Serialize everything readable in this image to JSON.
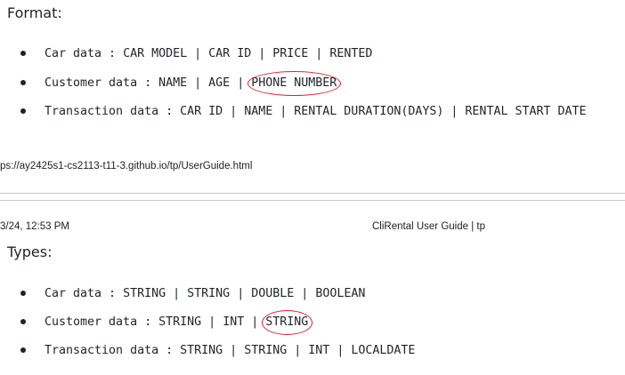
{
  "page1": {
    "heading": "Format:",
    "items": [
      {
        "label": "Car data",
        "separator": " : ",
        "fields": [
          "CAR MODEL",
          "CAR ID",
          "PRICE",
          "RENTED"
        ],
        "circled_index": -1
      },
      {
        "label": "Customer data",
        "separator": " : ",
        "fields": [
          "NAME",
          "AGE",
          "PHONE NUMBER"
        ],
        "circled_index": 2
      },
      {
        "label": "Transaction data",
        "separator": " : ",
        "fields": [
          "CAR ID",
          "NAME",
          "RENTAL DURATION(DAYS)",
          "RENTAL START DATE"
        ],
        "circled_index": -1
      }
    ],
    "footer_url": "ps://ay2425s1-cs2113-t11-3.github.io/tp/UserGuide.html"
  },
  "page2": {
    "header_left": "3/24, 12:53 PM",
    "header_right": "CliRental User Guide | tp",
    "heading": "Types:",
    "items": [
      {
        "label": "Car data",
        "separator": " : ",
        "fields": [
          "STRING",
          "STRING",
          "DOUBLE",
          "BOOLEAN"
        ],
        "circled_index": -1
      },
      {
        "label": "Customer data",
        "separator": " : ",
        "fields": [
          "STRING",
          "INT",
          "STRING"
        ],
        "circled_index": 2
      },
      {
        "label": "Transaction data",
        "separator": " : ",
        "fields": [
          "STRING",
          "STRING",
          "INT",
          "LOCALDATE"
        ],
        "circled_index": -1
      }
    ]
  },
  "colors": {
    "text": "#1f2328",
    "annotation": "#d9232e",
    "divider": "#c8c8c8"
  }
}
